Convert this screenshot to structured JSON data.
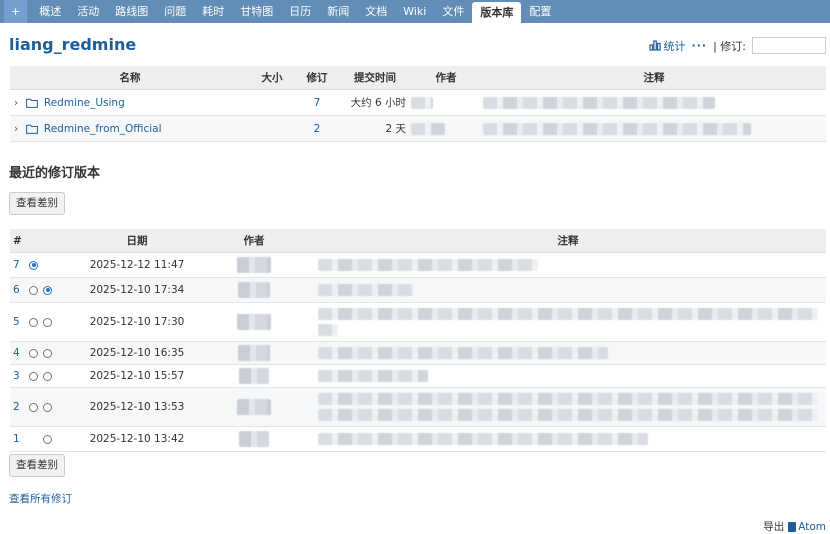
{
  "nav": {
    "plus": "+",
    "tabs": [
      "概述",
      "活动",
      "路线图",
      "问题",
      "耗时",
      "甘特图",
      "日历",
      "新闻",
      "文档",
      "Wiki",
      "文件",
      "版本库",
      "配置"
    ],
    "selected_index": 11
  },
  "project": {
    "title": "liang_redmine"
  },
  "contextual": {
    "stats_label": "统计",
    "more": "···",
    "revision_label": "| 修订:",
    "revision_value": ""
  },
  "entries": {
    "headers": {
      "name": "名称",
      "size": "大小",
      "revision": "修订",
      "age": "提交时间",
      "author": "作者",
      "comment": "注释"
    },
    "rows": [
      {
        "name": "Redmine_Using",
        "size": "",
        "revision": "7",
        "age": "大约 6 小时"
      },
      {
        "name": "Redmine_from_Official",
        "size": "",
        "revision": "2",
        "age": "2 天"
      }
    ]
  },
  "recent": {
    "title": "最近的修订版本",
    "diff_button": "查看差别",
    "headers": {
      "num": "#",
      "date": "日期",
      "author": "作者",
      "comment": "注释"
    },
    "rows": [
      {
        "rev": "7",
        "date": "2025-12-12 11:47",
        "radio1": true,
        "radio2": false,
        "show_radio1": true,
        "show_radio2": false
      },
      {
        "rev": "6",
        "date": "2025-12-10 17:34",
        "radio1": false,
        "radio2": true,
        "show_radio1": true,
        "show_radio2": true
      },
      {
        "rev": "5",
        "date": "2025-12-10 17:30",
        "radio1": false,
        "radio2": false,
        "show_radio1": true,
        "show_radio2": true
      },
      {
        "rev": "4",
        "date": "2025-12-10 16:35",
        "radio1": false,
        "radio2": false,
        "show_radio1": true,
        "show_radio2": true
      },
      {
        "rev": "3",
        "date": "2025-12-10 15:57",
        "radio1": false,
        "radio2": false,
        "show_radio1": true,
        "show_radio2": true
      },
      {
        "rev": "2",
        "date": "2025-12-10 13:53",
        "radio1": false,
        "radio2": false,
        "show_radio1": true,
        "show_radio2": true
      },
      {
        "rev": "1",
        "date": "2025-12-10 13:42",
        "radio1": false,
        "radio2": false,
        "show_radio1": false,
        "show_radio2": true
      }
    ],
    "view_all": "查看所有修订"
  },
  "footer": {
    "export_label": "导出",
    "atom_label": "Atom"
  },
  "colors": {
    "topbar": "#628db6",
    "link": "#1d5e9b",
    "header_bg": "#eeeeee"
  }
}
